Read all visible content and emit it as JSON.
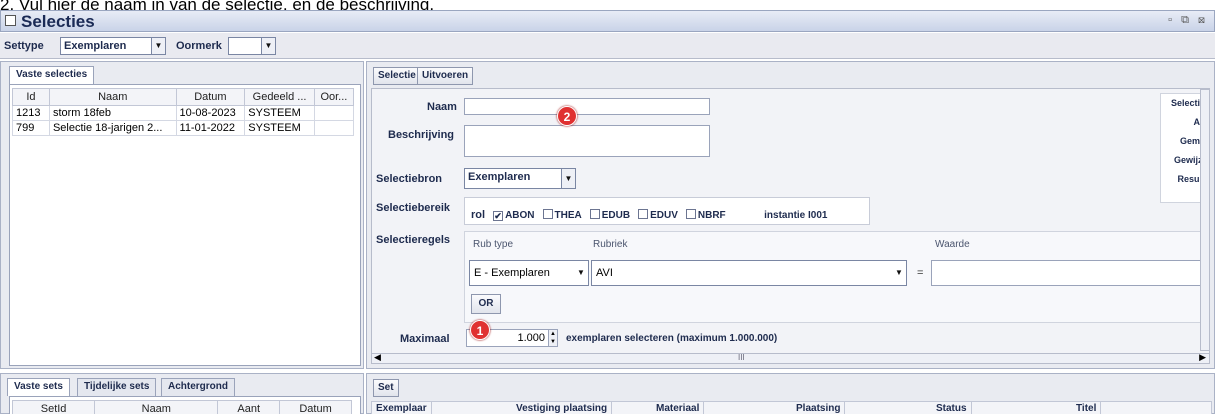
{
  "caption": "2. Vul hier de naam in van de selectie, en de beschrijving.",
  "window": {
    "title": "Selecties",
    "controls": "▫ ⧉ ⊠"
  },
  "toolbar": {
    "settype_label": "Settype",
    "settype_value": "Exemplaren",
    "oormerk_label": "Oormerk",
    "oormerk_value": ""
  },
  "left": {
    "tab": "Vaste selecties",
    "columns": [
      "Id",
      "Naam",
      "Datum",
      "Gedeeld ...",
      "Oor..."
    ],
    "rows": [
      [
        "1213",
        "storm 18feb",
        "10-08-2023",
        "SYSTEEM",
        ""
      ],
      [
        "799",
        "Selectie 18-jarigen 2...",
        "11-01-2022",
        "SYSTEEM",
        ""
      ]
    ]
  },
  "bottom_left": {
    "tabs": [
      "Vaste sets",
      "Tijdelijke sets",
      "Achtergrond"
    ],
    "columns": [
      "SetId",
      "Naam",
      "Aant",
      "Datum"
    ]
  },
  "right": {
    "tabs": [
      "Selectie",
      "Uitvoeren"
    ],
    "naam_label": "Naam",
    "naam_value": "",
    "beschrijving_label": "Beschrijving",
    "selectiebron_label": "Selectiebron",
    "selectiebron_value": "Exemplaren",
    "selectiebereik_label": "Selectiebereik",
    "rol_label": "rol",
    "rollen": [
      {
        "name": "ABON",
        "checked": true
      },
      {
        "name": "THEA",
        "checked": false
      },
      {
        "name": "EDUB",
        "checked": false
      },
      {
        "name": "EDUV",
        "checked": false
      },
      {
        "name": "NBRF",
        "checked": false
      }
    ],
    "instantie": "instantie I001",
    "selectieregels_label": "Selectieregels",
    "rubtype_header": "Rub type",
    "rubriek_header": "Rubriek",
    "waarde_header": "Waarde",
    "rubtype_value": "E - Exemplaren",
    "rubriek_value": "AVI",
    "equals": "=",
    "or_button": "OR",
    "maximaal_label": "Maximaal",
    "maximaal_value": "1.000",
    "maximaal_suffix": "exemplaren selecteren (maximum 1.000.000)",
    "side_labels": [
      "Selectie",
      "Ac",
      "Gema",
      "Gewijzi",
      "Result"
    ],
    "scroll_mark": "III"
  },
  "bottom_right": {
    "button": "Set",
    "columns": [
      "Exemplaar",
      "Vestiging plaatsing",
      "Materiaal",
      "Plaatsing",
      "Status",
      "Titel"
    ]
  },
  "badges": {
    "one": "1",
    "two": "2"
  },
  "colors": {
    "badge": "#e03131",
    "titlebar": "#c9d3e8",
    "label": "#1e2b4e"
  }
}
